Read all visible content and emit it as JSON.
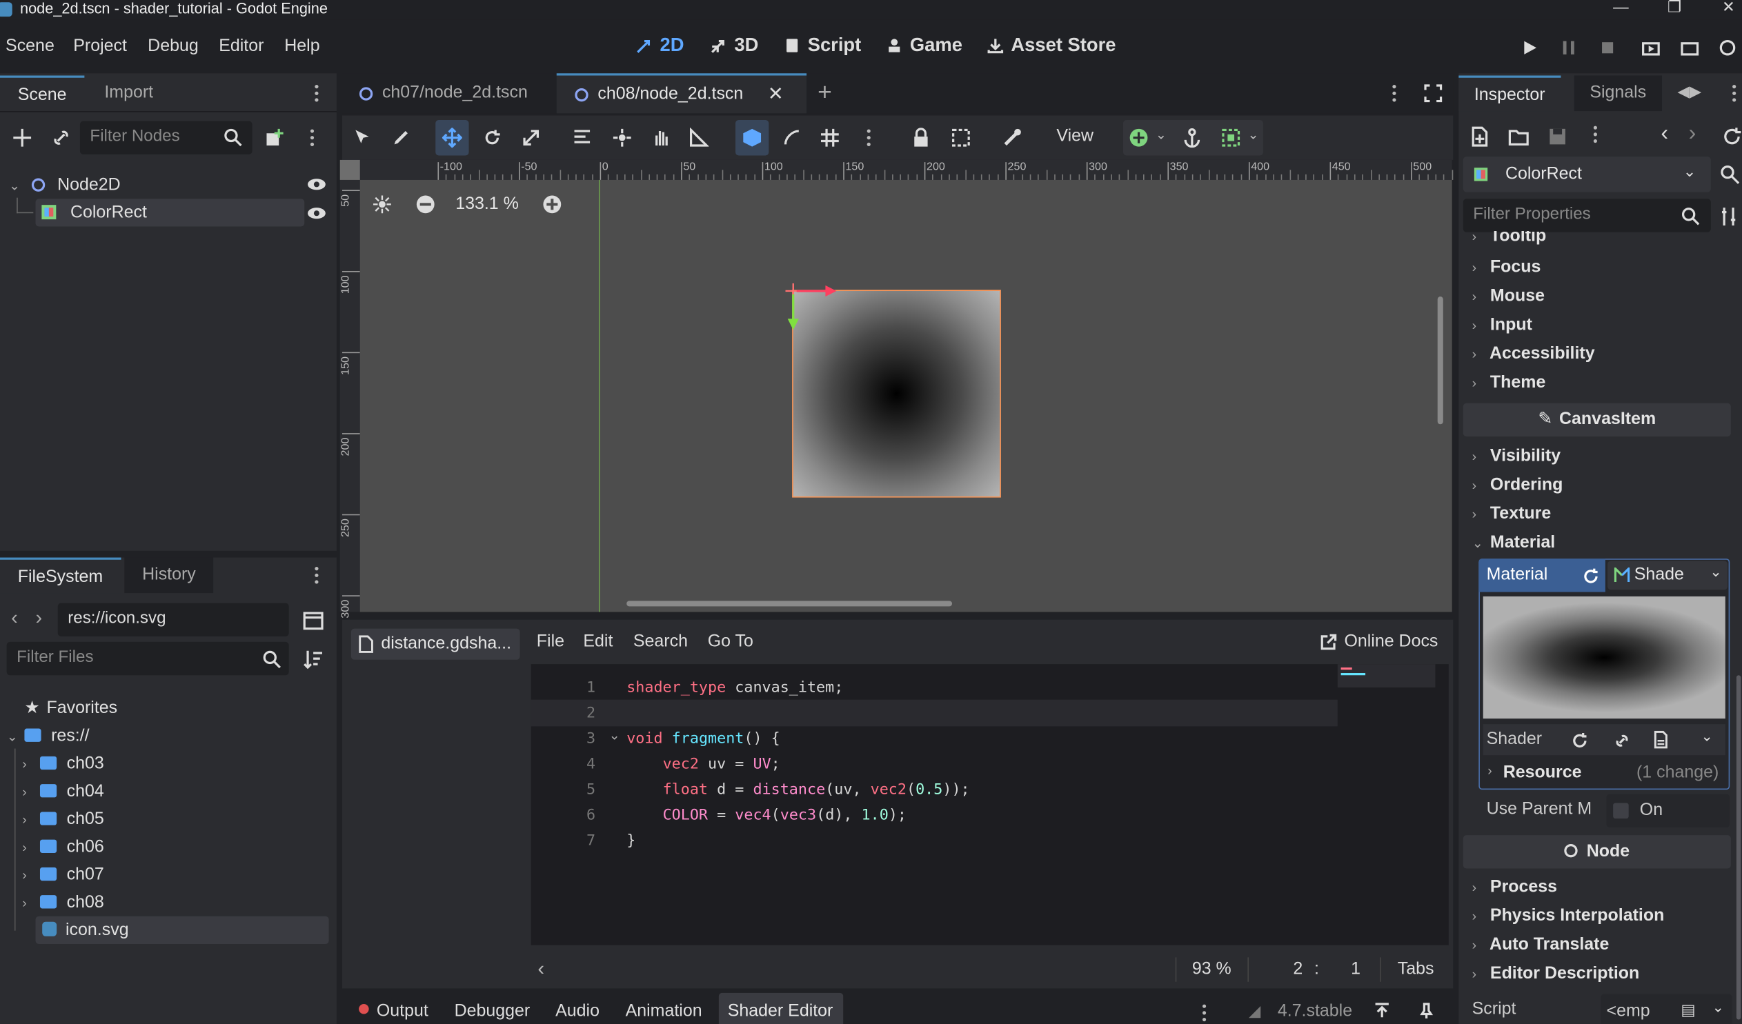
{
  "window": {
    "title": "node_2d.tscn - shader_tutorial - Godot Engine"
  },
  "menu": [
    "Scene",
    "Project",
    "Debug",
    "Editor",
    "Help"
  ],
  "workspaces": [
    {
      "label": "2D",
      "icon": "2d-icon",
      "active": true
    },
    {
      "label": "3D",
      "icon": "3d-icon",
      "active": false
    },
    {
      "label": "Script",
      "icon": "script-icon",
      "active": false
    },
    {
      "label": "Game",
      "icon": "game-icon",
      "active": false
    },
    {
      "label": "Asset Store",
      "icon": "asset-store-icon",
      "active": false
    }
  ],
  "scene_dock": {
    "tabs": [
      "Scene",
      "Import"
    ],
    "filter_placeholder": "Filter Nodes",
    "nodes": [
      {
        "name": "Node2D",
        "icon": "node2d-icon"
      },
      {
        "name": "ColorRect",
        "icon": "colorrect-icon",
        "selected": true
      }
    ]
  },
  "filesystem": {
    "tabs": [
      "FileSystem",
      "History"
    ],
    "path": "res://icon.svg",
    "filter_placeholder": "Filter Files",
    "favorites": "Favorites",
    "root": "res://",
    "folders": [
      "ch03",
      "ch04",
      "ch05",
      "ch06",
      "ch07",
      "ch08"
    ],
    "selected_file": "icon.svg"
  },
  "scene_tabs": [
    "ch07/node_2d.tscn",
    "ch08/node_2d.tscn"
  ],
  "toolbar": {
    "view_label": "View"
  },
  "viewport": {
    "zoom": "133.1 %",
    "ruler_h": [
      "-100",
      "-50",
      "0",
      "50",
      "100",
      "150",
      "200",
      "250",
      "300",
      "350",
      "400",
      "450",
      "500"
    ],
    "ruler_v": [
      "50",
      "100",
      "150",
      "200",
      "250",
      "300"
    ]
  },
  "shader_editor": {
    "file_tab": "distance.gdsha...",
    "menu": [
      "File",
      "Edit",
      "Search",
      "Go To"
    ],
    "online_docs": "Online Docs",
    "lines": [
      "1",
      "2",
      "3",
      "4",
      "5",
      "6",
      "7"
    ],
    "zoom": "93 %",
    "line": "2",
    "col": "1",
    "indent": "Tabs"
  },
  "bottom_tabs": [
    "Output",
    "Debugger",
    "Audio",
    "Animation",
    "Shader Editor"
  ],
  "version": "4.7.stable",
  "inspector": {
    "tabs": [
      "Inspector",
      "Signals"
    ],
    "object": "ColorRect",
    "filter_placeholder": "Filter Properties",
    "control_sections": [
      "Tooltip",
      "Focus",
      "Mouse",
      "Input",
      "Accessibility",
      "Theme"
    ],
    "canvasitem_header": "CanvasItem",
    "canvasitem_sections": [
      "Visibility",
      "Ordering",
      "Texture",
      "Material"
    ],
    "material_label": "Material",
    "material_type": "Shade",
    "shader_label": "Shader",
    "resource_label": "Resource",
    "resource_changes": "(1 change)",
    "use_parent_label": "Use Parent M",
    "use_parent_value": "On",
    "node_header": "Node",
    "node_sections": [
      "Process",
      "Physics Interpolation",
      "Auto Translate",
      "Editor Description"
    ],
    "script_label": "Script",
    "script_value": "<emp"
  },
  "colors": {
    "accent": "#478cbf",
    "selection_outline": "#ff9a5b",
    "active_workspace": "#5fa8ff"
  }
}
